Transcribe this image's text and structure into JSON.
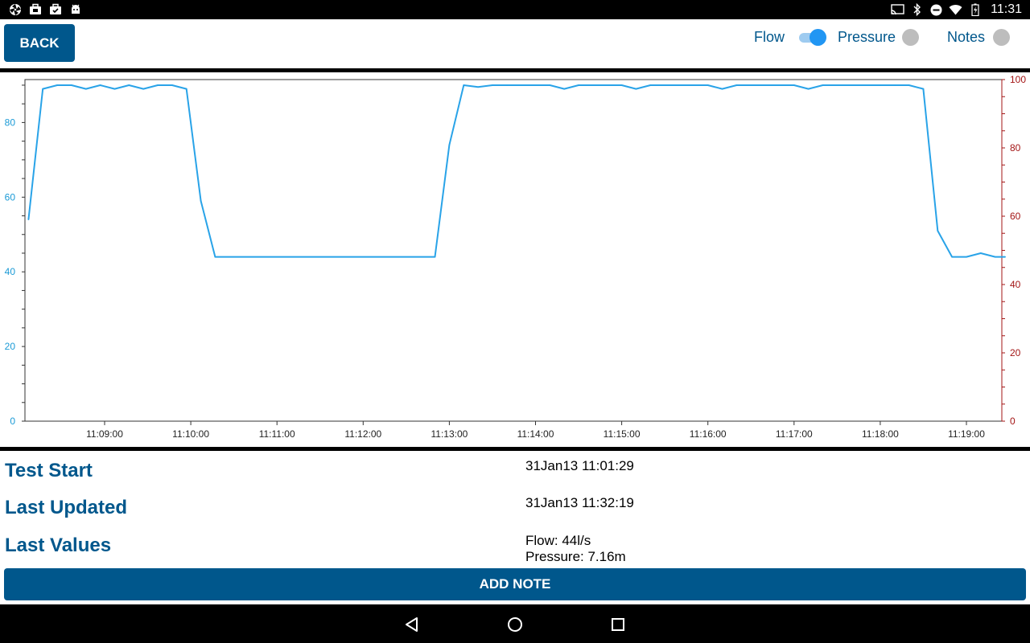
{
  "status_bar": {
    "time": "11:31",
    "left_icons": [
      "aperture-icon",
      "briefcase-icon",
      "briefcase-check-icon",
      "android-icon"
    ],
    "right_icons": [
      "cast-icon",
      "bluetooth-icon",
      "do-not-disturb-icon",
      "wifi-icon",
      "battery-icon"
    ]
  },
  "toolbar": {
    "back_label": "BACK",
    "toggles": [
      {
        "label": "Flow",
        "on": true
      },
      {
        "label": "Pressure",
        "on": false
      },
      {
        "label": "Notes",
        "on": false
      }
    ]
  },
  "colors": {
    "brand": "#00578c",
    "flow_line": "#29a3e8",
    "left_axis": "#1a9ad6",
    "right_axis": "#a31515"
  },
  "chart_data": {
    "type": "line",
    "x_tick_labels": [
      "11:09:00",
      "11:10:00",
      "11:11:00",
      "11:12:00",
      "11:13:00",
      "11:14:00",
      "11:15:00",
      "11:16:00",
      "11:17:00",
      "11:18:00",
      "11:19:00"
    ],
    "left_axis": {
      "ticks": [
        0,
        20,
        40,
        60,
        80
      ],
      "ylim": [
        0,
        91.5
      ]
    },
    "right_axis": {
      "ticks": [
        0,
        20,
        40,
        60,
        80,
        100
      ],
      "ylim": [
        0,
        100
      ]
    },
    "grid": false,
    "series": [
      {
        "axis": "left",
        "x": [
          "11:08:07",
          "11:08:17",
          "11:08:27",
          "11:08:37",
          "11:08:47",
          "11:08:57",
          "11:09:07",
          "11:09:17",
          "11:09:27",
          "11:09:37",
          "11:09:47",
          "11:09:57",
          "11:10:07",
          "11:10:17",
          "11:12:50",
          "11:13:00",
          "11:13:10",
          "11:13:20",
          "11:13:30",
          "11:13:40",
          "11:14:10",
          "11:14:20",
          "11:14:30",
          "11:15:00",
          "11:15:10",
          "11:15:20",
          "11:16:00",
          "11:16:10",
          "11:16:20",
          "11:17:00",
          "11:17:10",
          "11:17:20",
          "11:18:00",
          "11:18:10",
          "11:18:20",
          "11:18:30",
          "11:18:40",
          "11:18:50",
          "11:19:00",
          "11:19:10",
          "11:19:20",
          "11:19:27"
        ],
        "values": [
          54,
          89,
          90,
          90,
          89,
          90,
          89,
          90,
          89,
          90,
          90,
          89,
          59,
          44,
          44,
          74,
          90,
          89.5,
          90,
          90,
          90,
          89,
          90,
          90,
          89,
          90,
          90,
          89,
          90,
          90,
          89,
          90,
          90,
          90,
          90,
          89,
          51,
          44,
          44,
          45,
          44,
          44
        ]
      }
    ]
  },
  "info": {
    "test_start_label": "Test Start",
    "test_start_value": "31Jan13 11:01:29",
    "last_updated_label": "Last Updated",
    "last_updated_value": "31Jan13 11:32:19",
    "last_values_label": "Last Values",
    "last_values_flow": "Flow: 44l/s",
    "last_values_pressure": "Pressure: 7.16m"
  },
  "add_note_label": "ADD NOTE",
  "nav_bar": [
    "back-nav-icon",
    "home-nav-icon",
    "recents-nav-icon"
  ]
}
